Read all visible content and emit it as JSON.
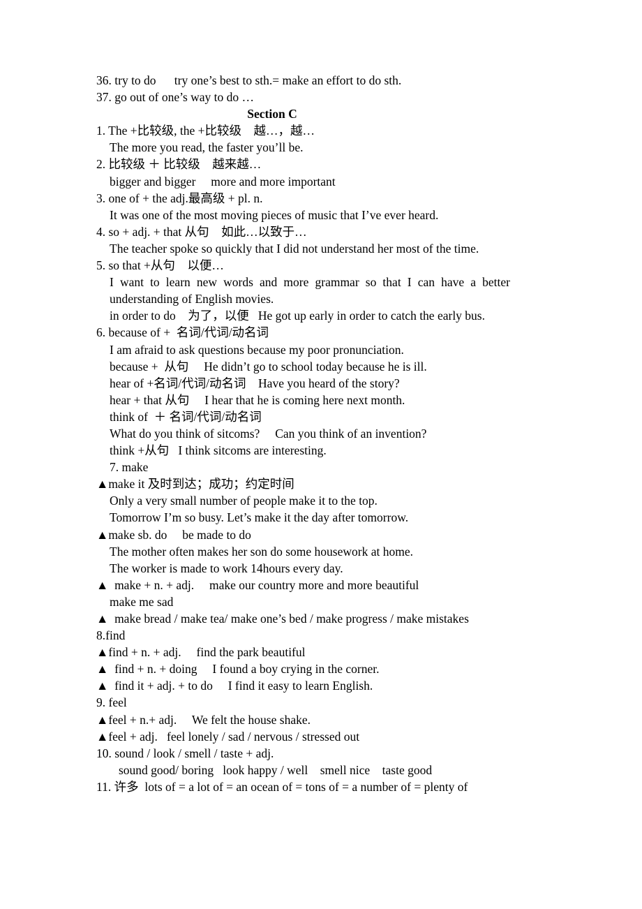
{
  "document": {
    "section_heading": "Section C",
    "lines": [
      {
        "id": "l36",
        "indent": 0,
        "text": "36. try to do      try one’s best to sth.= make an effort to do sth."
      },
      {
        "id": "l37",
        "indent": 0,
        "text": "37. go out of one’s way to do …"
      },
      {
        "id": "i1",
        "indent": 0,
        "text": "1. The +比较级, the +比较级 越…，越…"
      },
      {
        "id": "i1a",
        "indent": 1,
        "text": "The more you read, the faster you’ll be."
      },
      {
        "id": "i2",
        "indent": 0,
        "text": "2. 比较级 ＋ 比较级 越来越…"
      },
      {
        "id": "i2a",
        "indent": 1,
        "text": "bigger and bigger  more and more important"
      },
      {
        "id": "i3",
        "indent": 0,
        "text": "3. one of + the adj.最高级 + pl. n."
      },
      {
        "id": "i3a",
        "indent": 1,
        "text": "It was one of the most moving pieces of music that I’ve ever heard."
      },
      {
        "id": "i4",
        "indent": 0,
        "text": "4. so + adj. + that 从句 如此…以致于…"
      },
      {
        "id": "i4a",
        "indent": 1,
        "text": "The teacher spoke so quickly that I did not understand her most of the time."
      },
      {
        "id": "i5",
        "indent": 0,
        "text": "5. so that +从句 以便…"
      },
      {
        "id": "i5a",
        "indent": 1,
        "justify": true,
        "text": "I want to learn new words and more grammar so that I can have a better understanding of English movies."
      },
      {
        "id": "i5b",
        "indent": 1,
        "text": "in order to do 为了，以便  He got up early in order to catch the early bus."
      },
      {
        "id": "i6",
        "indent": 0,
        "text": "6. because of +  名词/代词/动名词"
      },
      {
        "id": "i6a",
        "indent": 1,
        "text": "I am afraid to ask questions because my poor pronunciation."
      },
      {
        "id": "i6b",
        "indent": 1,
        "text": "because +  从句  He didn’t go to school today because he is ill."
      },
      {
        "id": "i6c",
        "indent": 1,
        "text": "hear of +名词/代词/动名词 Have you heard of the story?"
      },
      {
        "id": "i6d",
        "indent": 1,
        "text": "hear + that 从句  I hear that he is coming here next month."
      },
      {
        "id": "i6e",
        "indent": 1,
        "text": "think of  ＋ 名词/代词/动名词"
      },
      {
        "id": "i6f",
        "indent": 1,
        "text": "What do you think of sitcoms?  Can you think of an invention?"
      },
      {
        "id": "i6g",
        "indent": 1,
        "text": "think +从句  I think sitcoms are interesting."
      },
      {
        "id": "i7",
        "indent": 1,
        "text": "7. make"
      },
      {
        "id": "i7a",
        "indent": 0,
        "text": "▲make it 及时到达；成功；约定时间"
      },
      {
        "id": "i7b",
        "indent": 1,
        "text": "Only a very small number of people make it to the top."
      },
      {
        "id": "i7c",
        "indent": 1,
        "text": "Tomorrow I’m so busy. Let’s make it the day after tomorrow."
      },
      {
        "id": "i7d",
        "indent": 0,
        "text": "▲make sb. do  be made to do"
      },
      {
        "id": "i7e",
        "indent": 1,
        "text": "The mother often makes her son do some housework at home."
      },
      {
        "id": "i7f",
        "indent": 1,
        "text": "The worker is made to work 14hours every day."
      },
      {
        "id": "i7g",
        "indent": 0,
        "text": "▲  make + n. + adj.  make our country more and more beautiful"
      },
      {
        "id": "i7h",
        "indent": 1,
        "text": "make me sad"
      },
      {
        "id": "i7i",
        "indent": 0,
        "text": "▲  make bread / make tea/ make one’s bed / make progress / make mistakes"
      },
      {
        "id": "i8",
        "indent": 0,
        "text": "8.find"
      },
      {
        "id": "i8a",
        "indent": 0,
        "text": "▲find + n. + adj.   find the park beautiful"
      },
      {
        "id": "i8b",
        "indent": 0,
        "text": "▲  find + n. + doing  I found a boy crying in the corner."
      },
      {
        "id": "i8c",
        "indent": 0,
        "text": "▲  find it + adj. + to do  I find it easy to learn English."
      },
      {
        "id": "i9",
        "indent": 0,
        "text": "9. feel"
      },
      {
        "id": "i9a",
        "indent": 0,
        "text": "▲feel + n.+ adj.   We felt the house shake."
      },
      {
        "id": "i9b",
        "indent": 0,
        "text": "▲feel + adj.  feel lonely / sad / nervous / stressed out"
      },
      {
        "id": "i10",
        "indent": 0,
        "text": "10. sound / look / smell / taste + adj."
      },
      {
        "id": "i10a",
        "indent": 2,
        "text": "sound good/ boring  look happy / well   smell nice   taste good"
      },
      {
        "id": "i11",
        "indent": 0,
        "text": "11. 许多  lots of = a lot of = an ocean of = tons of = a number of = plenty of"
      }
    ]
  }
}
